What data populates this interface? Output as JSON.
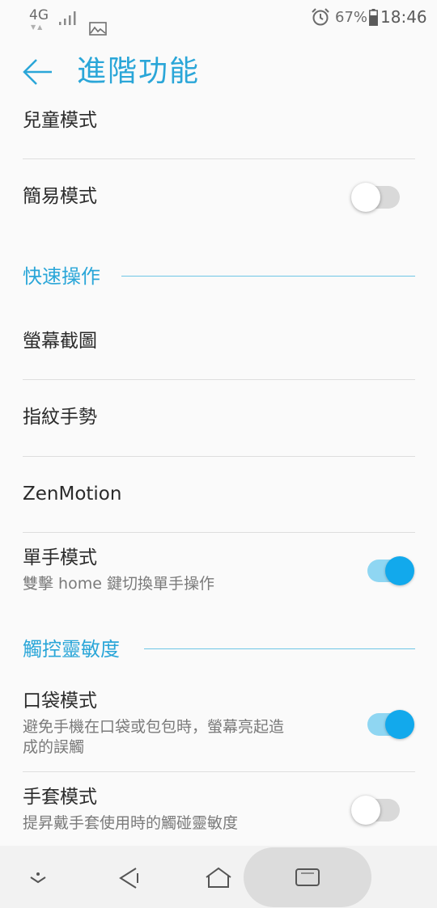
{
  "status_bar": {
    "network_type": "4G",
    "network_arrows": "▼▲",
    "battery_percent": "67%",
    "time": "18:46",
    "icons": [
      "signal-icon",
      "gallery-notification-icon",
      "alarm-icon",
      "battery-icon"
    ]
  },
  "app_bar": {
    "title": "進階功能",
    "back_icon": "arrow-left-icon"
  },
  "rows": {
    "kids_mode": {
      "title": "兒童模式"
    },
    "easy_mode": {
      "title": "簡易模式",
      "toggle_on": false
    },
    "screenshot": {
      "title": "螢幕截圖"
    },
    "fingerprint_gestures": {
      "title": "指紋手勢"
    },
    "zenmotion": {
      "title": "ZenMotion"
    },
    "one_hand_mode": {
      "title": "單手模式",
      "subtitle": "雙擊 home 鍵切換單手操作",
      "toggle_on": true
    },
    "pocket_mode": {
      "title": "口袋模式",
      "subtitle": "避免手機在口袋或包包時，螢幕亮起造成的誤觸",
      "toggle_on": true
    },
    "glove_mode": {
      "title": "手套模式",
      "subtitle": "提昇戴手套使用時的觸碰靈敏度",
      "toggle_on": false
    }
  },
  "sections": {
    "quick_actions": "快速操作",
    "touch_sensitivity": "觸控靈敏度"
  },
  "nav_bar": {
    "icons": [
      "hide-nav-icon",
      "back-triangle-icon",
      "home-icon",
      "recents-icon"
    ]
  },
  "colors": {
    "accent": "#2aa6d8",
    "toggle_on_thumb": "#12a9ec",
    "toggle_on_track": "#8fd6f2",
    "toggle_off_track": "#d9d9d9"
  }
}
